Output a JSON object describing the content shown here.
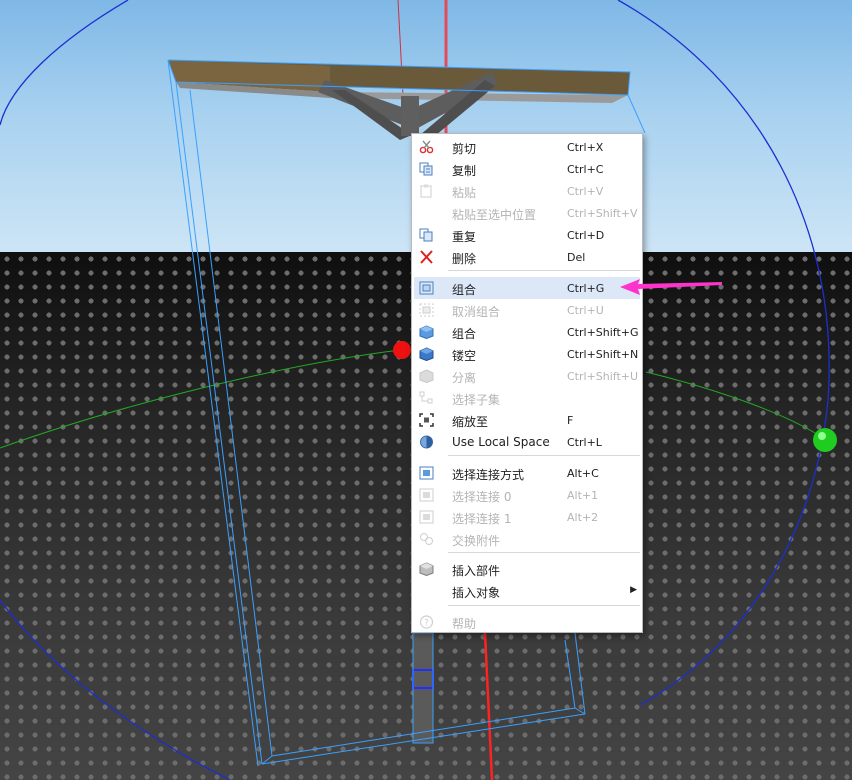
{
  "context_menu": {
    "items": [
      {
        "label": "剪切",
        "shortcut": "Ctrl+X",
        "icon": "scissors-icon",
        "enabled": true
      },
      {
        "label": "复制",
        "shortcut": "Ctrl+C",
        "icon": "copy-icon",
        "enabled": true
      },
      {
        "label": "粘贴",
        "shortcut": "Ctrl+V",
        "icon": "paste-icon",
        "enabled": false
      },
      {
        "label": "粘贴至选中位置",
        "shortcut": "Ctrl+Shift+V",
        "icon": "",
        "enabled": false
      },
      {
        "label": "重复",
        "shortcut": "Ctrl+D",
        "icon": "duplicate-icon",
        "enabled": true
      },
      {
        "label": "删除",
        "shortcut": "Del",
        "icon": "delete-x-icon",
        "enabled": true
      },
      {
        "label": "组合",
        "shortcut": "Ctrl+G",
        "icon": "group-icon",
        "enabled": true,
        "highlighted": true
      },
      {
        "label": "取消组合",
        "shortcut": "Ctrl+U",
        "icon": "ungroup-icon",
        "enabled": false
      },
      {
        "label": "组合",
        "shortcut": "Ctrl+Shift+G",
        "icon": "union-icon",
        "enabled": true
      },
      {
        "label": "镂空",
        "shortcut": "Ctrl+Shift+N",
        "icon": "negate-icon",
        "enabled": true
      },
      {
        "label": "分离",
        "shortcut": "Ctrl+Shift+U",
        "icon": "separate-icon",
        "enabled": false
      },
      {
        "label": "选择子集",
        "shortcut": "",
        "icon": "select-children-icon",
        "enabled": false
      },
      {
        "label": "缩放至",
        "shortcut": "F",
        "icon": "zoom-to-icon",
        "enabled": true
      },
      {
        "label": "Use Local Space",
        "shortcut": "Ctrl+L",
        "icon": "local-space-icon",
        "enabled": true
      },
      {
        "label": "选择连接方式",
        "shortcut": "Alt+C",
        "icon": "select-constraint-icon",
        "enabled": true
      },
      {
        "label": "选择连接 0",
        "shortcut": "Alt+1",
        "icon": "select-constraint0-icon",
        "enabled": false
      },
      {
        "label": "选择连接 1",
        "shortcut": "Alt+2",
        "icon": "select-constraint1-icon",
        "enabled": false
      },
      {
        "label": "交换附件",
        "shortcut": "",
        "icon": "swap-attachments-icon",
        "enabled": false
      },
      {
        "label": "插入部件",
        "shortcut": "",
        "icon": "insert-part-icon",
        "enabled": true
      },
      {
        "label": "插入对象",
        "shortcut": "",
        "icon": "",
        "enabled": true,
        "submenu": true
      },
      {
        "label": "帮助",
        "shortcut": "",
        "icon": "help-icon",
        "enabled": false
      }
    ]
  },
  "colors": {
    "highlight": "#dce8f8",
    "arrow": "#ff33cc",
    "selection_box": "#3aa0ff",
    "rotate_blue": "#1c2fd0",
    "rotate_green": "#22cc22",
    "rotate_red": "#ff2222"
  }
}
